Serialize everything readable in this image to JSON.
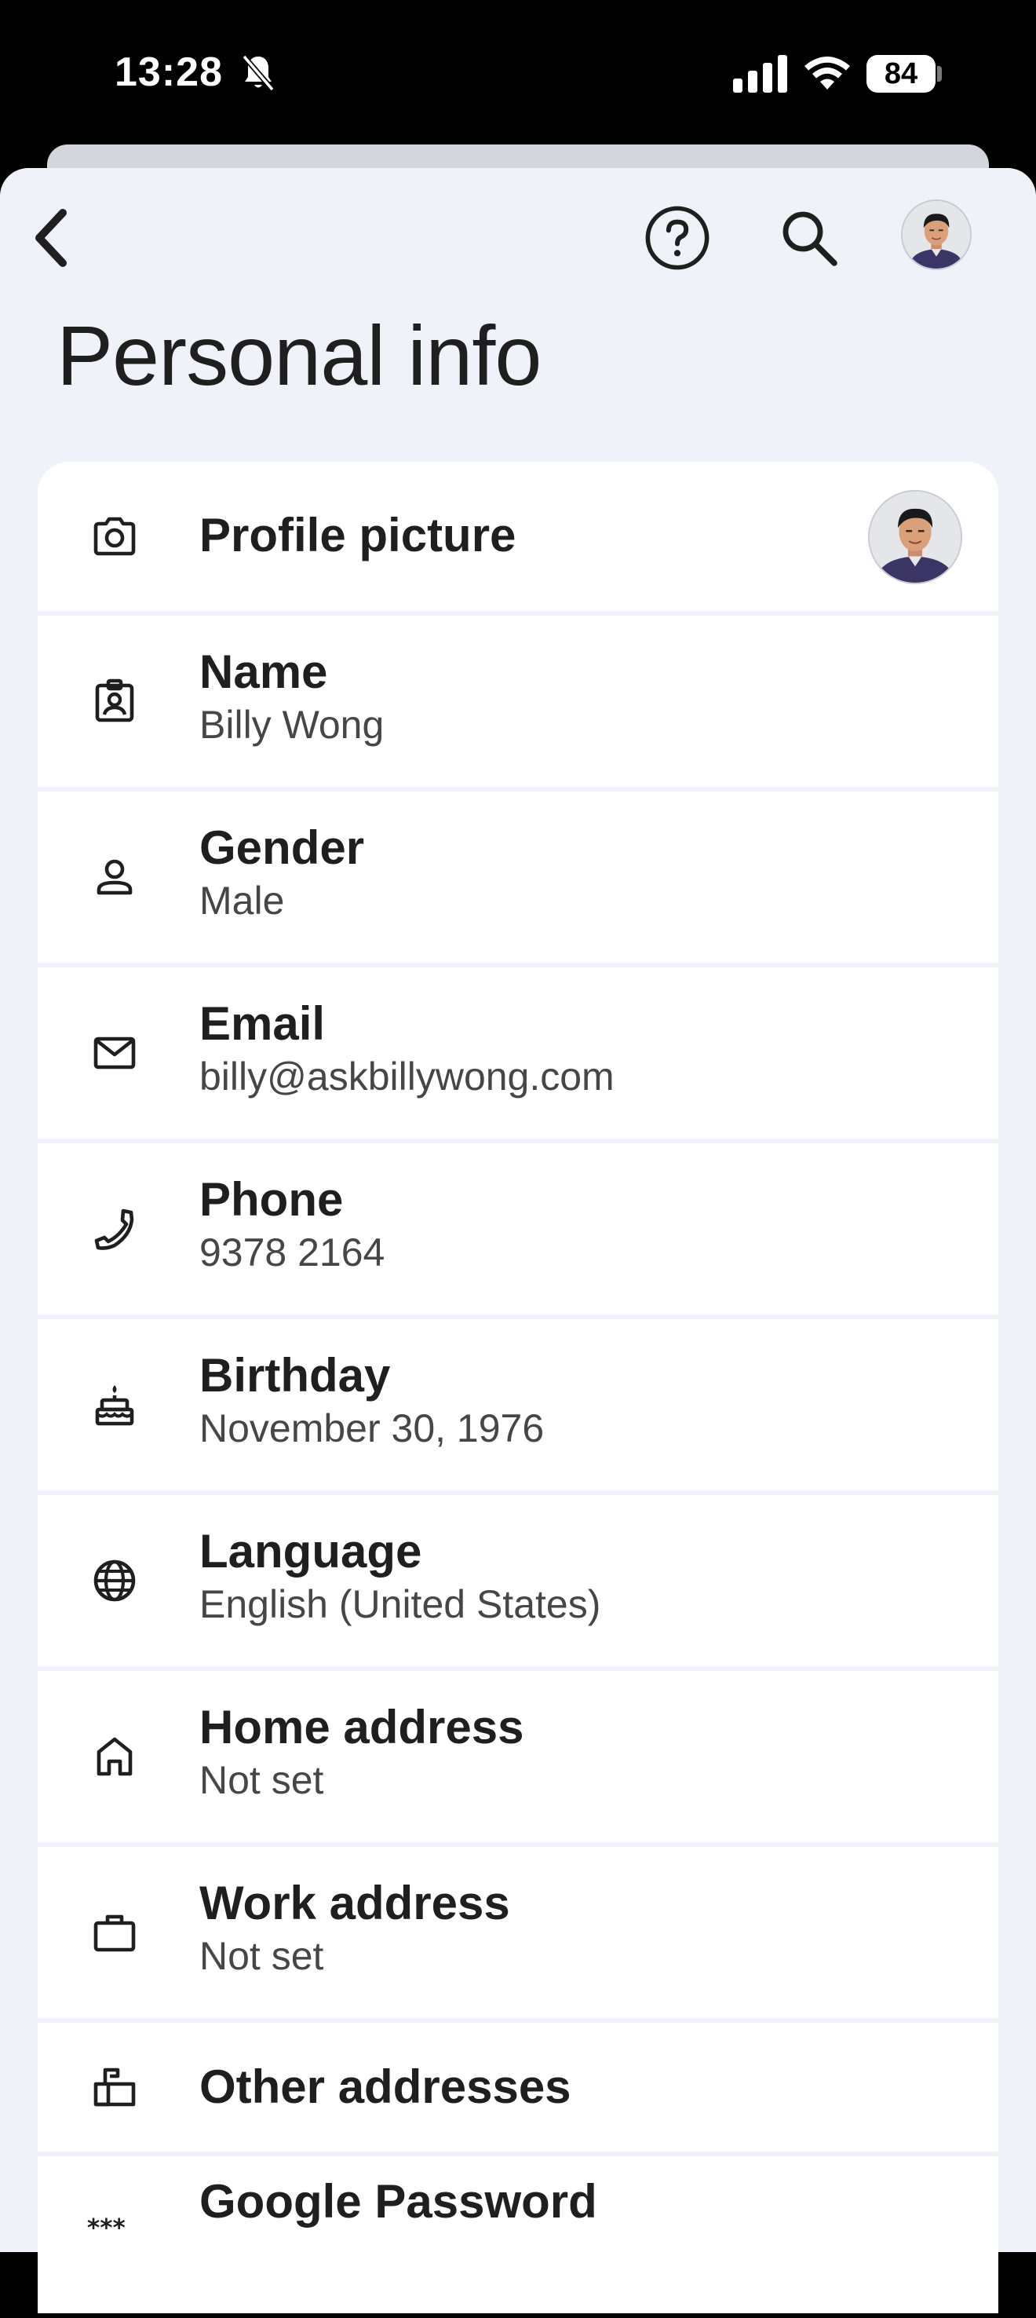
{
  "status_bar": {
    "time": "13:28",
    "battery": "84",
    "icons": [
      "bell-slash-icon",
      "signal-icon",
      "wifi-icon",
      "battery-icon"
    ]
  },
  "header": {
    "back_icon": "chevron-left-icon",
    "help_icon": "help-circle-icon",
    "search_icon": "search-icon",
    "avatar": "avatar"
  },
  "page": {
    "title": "Personal info"
  },
  "items": [
    {
      "label": "Profile picture",
      "value": "",
      "icon": "camera-icon"
    },
    {
      "label": "Name",
      "value": "Billy Wong",
      "icon": "badge-icon"
    },
    {
      "label": "Gender",
      "value": "Male",
      "icon": "person-icon"
    },
    {
      "label": "Email",
      "value": "billy@askbillywong.com",
      "icon": "mail-icon"
    },
    {
      "label": "Phone",
      "value": "9378 2164",
      "icon": "phone-icon"
    },
    {
      "label": "Birthday",
      "value": "November 30, 1976",
      "icon": "cake-icon"
    },
    {
      "label": "Language",
      "value": "English (United States)",
      "icon": "globe-icon"
    },
    {
      "label": "Home address",
      "value": "Not set",
      "icon": "home-icon"
    },
    {
      "label": "Work address",
      "value": "Not set",
      "icon": "briefcase-icon"
    },
    {
      "label": "Other addresses",
      "value": "",
      "icon": "mailbox-icon"
    },
    {
      "label": "Google Password",
      "value": "",
      "icon": "password-icon"
    }
  ],
  "colors": {
    "background": "#eff2f8",
    "card": "#ffffff",
    "text_primary": "#1f1f1f",
    "text_secondary": "#444746"
  }
}
